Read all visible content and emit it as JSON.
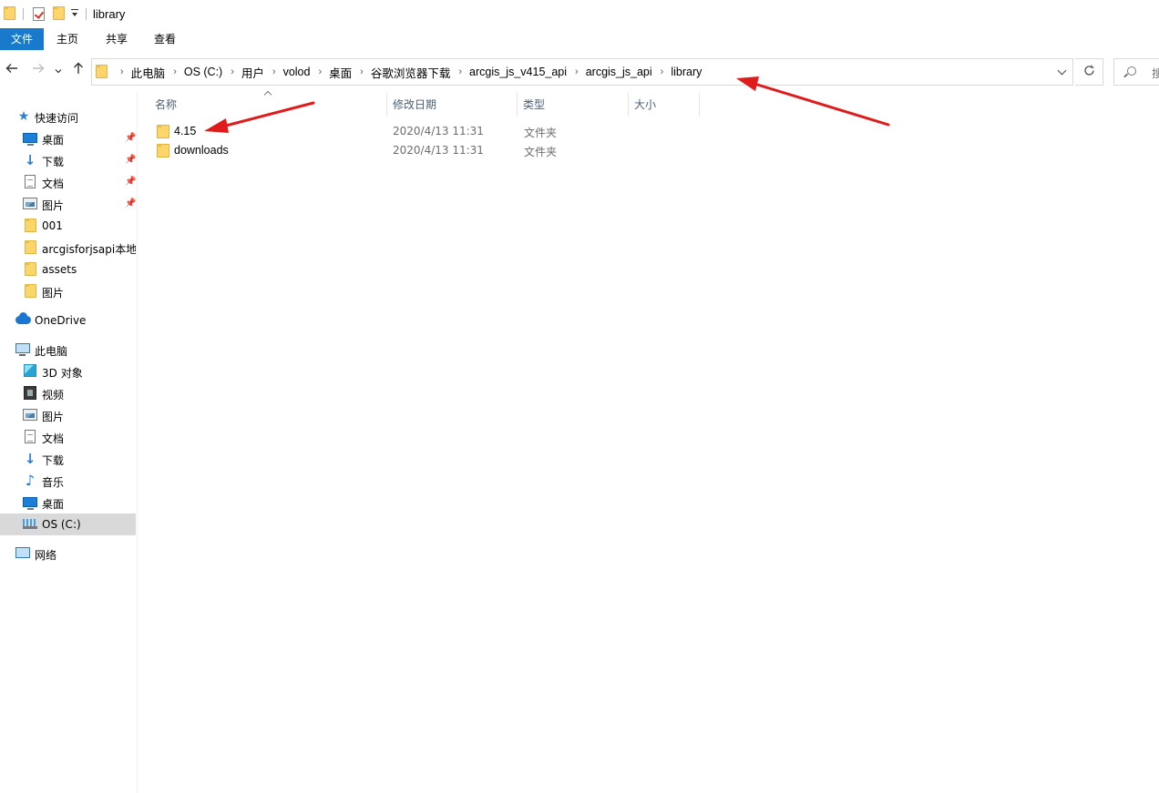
{
  "window": {
    "title": "library"
  },
  "ribbon": {
    "tabs": [
      {
        "label": "文件",
        "active": true
      },
      {
        "label": "主页"
      },
      {
        "label": "共享"
      },
      {
        "label": "查看"
      }
    ]
  },
  "nav": {
    "back_icon": "arrow-left",
    "forward_icon": "arrow-right",
    "recent_icon": "chevron-down",
    "up_icon": "arrow-up",
    "breadcrumbs": [
      "此电脑",
      "OS (C:)",
      "用户",
      "volod",
      "桌面",
      "谷歌浏览器下载",
      "arcgis_js_v415_api",
      "arcgis_js_api",
      "library"
    ],
    "refresh_icon": "refresh",
    "search_placeholder": "搜"
  },
  "sidebar": {
    "quick_access": {
      "label": "快速访问",
      "items": [
        {
          "label": "桌面",
          "icon": "desktop-icon",
          "pinned": true
        },
        {
          "label": "下载",
          "icon": "download-icon",
          "pinned": true
        },
        {
          "label": "文档",
          "icon": "document-icon",
          "pinned": true
        },
        {
          "label": "图片",
          "icon": "picture-icon",
          "pinned": true
        },
        {
          "label": "001",
          "icon": "folder-icon"
        },
        {
          "label": "arcgisforjsapi本地",
          "icon": "folder-icon"
        },
        {
          "label": "assets",
          "icon": "folder-icon"
        },
        {
          "label": "图片",
          "icon": "folder-icon"
        }
      ]
    },
    "onedrive": {
      "label": "OneDrive"
    },
    "this_pc": {
      "label": "此电脑",
      "items": [
        {
          "label": "3D 对象",
          "icon": "cube-icon"
        },
        {
          "label": "视频",
          "icon": "video-icon"
        },
        {
          "label": "图片",
          "icon": "picture-icon"
        },
        {
          "label": "文档",
          "icon": "document-icon"
        },
        {
          "label": "下载",
          "icon": "download-icon"
        },
        {
          "label": "音乐",
          "icon": "music-icon"
        },
        {
          "label": "桌面",
          "icon": "desktop-icon"
        },
        {
          "label": "OS (C:)",
          "icon": "drive-icon",
          "selected": true
        }
      ]
    },
    "network": {
      "label": "网络"
    }
  },
  "columns": {
    "name": "名称",
    "date": "修改日期",
    "type": "类型",
    "size": "大小"
  },
  "files": [
    {
      "name": "4.15",
      "date": "2020/4/13 11:31",
      "type": "文件夹"
    },
    {
      "name": "downloads",
      "date": "2020/4/13 11:31",
      "type": "文件夹"
    }
  ],
  "colors": {
    "file_tab": "#1979ca",
    "selection": "#d9d9d9",
    "header_text": "#4c607a",
    "annotation_arrow": "#e01b1b"
  }
}
